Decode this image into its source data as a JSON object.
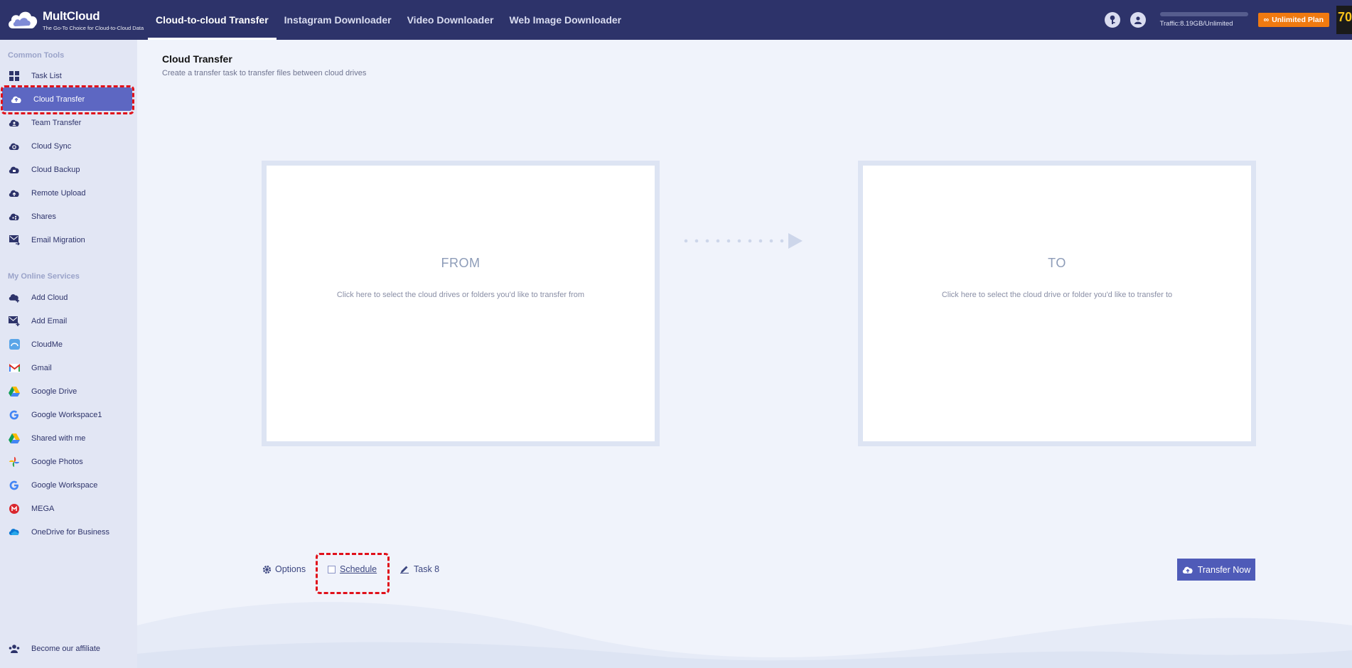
{
  "app": {
    "logo_name": "MultCloud",
    "logo_tagline": "The Go-To Choice for Cloud-to-Cloud Data"
  },
  "nav": {
    "items": [
      {
        "label": "Cloud-to-cloud Transfer",
        "active": true
      },
      {
        "label": "Instagram Downloader",
        "active": false
      },
      {
        "label": "Video Downloader",
        "active": false
      },
      {
        "label": "Web Image Downloader",
        "active": false
      }
    ]
  },
  "header": {
    "traffic_text": "Traffic:8.19GB/Unlimited",
    "plan_label": "Unlimited Plan",
    "corner_badge": "70"
  },
  "sidebar": {
    "common_title": "Common Tools",
    "common_items": [
      {
        "label": "Task List",
        "icon": "grid-icon"
      },
      {
        "label": "Cloud Transfer",
        "icon": "cloud-transfer-icon",
        "active": true
      },
      {
        "label": "Team Transfer",
        "icon": "team-transfer-icon"
      },
      {
        "label": "Cloud Sync",
        "icon": "cloud-sync-icon"
      },
      {
        "label": "Cloud Backup",
        "icon": "cloud-backup-icon"
      },
      {
        "label": "Remote Upload",
        "icon": "remote-upload-icon"
      },
      {
        "label": "Shares",
        "icon": "shares-icon"
      },
      {
        "label": "Email Migration",
        "icon": "email-migration-icon"
      }
    ],
    "online_title": "My Online Services",
    "online_items": [
      {
        "label": "Add Cloud",
        "icon": "add-cloud-icon"
      },
      {
        "label": "Add Email",
        "icon": "add-email-icon"
      },
      {
        "label": "CloudMe",
        "icon": "cloudme-icon"
      },
      {
        "label": "Gmail",
        "icon": "gmail-icon"
      },
      {
        "label": "Google Drive",
        "icon": "google-drive-icon"
      },
      {
        "label": "Google Workspace1",
        "icon": "google-icon"
      },
      {
        "label": "Shared with me",
        "icon": "google-drive-icon"
      },
      {
        "label": "Google Photos",
        "icon": "google-photos-icon"
      },
      {
        "label": "Google Workspace",
        "icon": "google-icon"
      },
      {
        "label": "MEGA",
        "icon": "mega-icon"
      },
      {
        "label": "OneDrive for Business",
        "icon": "onedrive-icon"
      }
    ],
    "footer_items": [
      {
        "label": "Become our affiliate",
        "icon": "affiliate-icon"
      }
    ]
  },
  "main": {
    "title": "Cloud Transfer",
    "subtitle": "Create a transfer task to transfer files between cloud drives",
    "from_title": "FROM",
    "from_desc": "Click here to select the cloud drives or folders you'd like to transfer from",
    "to_title": "TO",
    "to_desc": "Click here to select the cloud drive or folder you'd like to transfer to",
    "options_label": "Options",
    "schedule_label": "Schedule",
    "schedule_checked": false,
    "task_name": "Task 8",
    "transfer_label": "Transfer Now"
  },
  "colors": {
    "topbar": "#2d336a",
    "sidebar": "#e2e6f4",
    "accent": "#5d67c2",
    "plan": "#f07a10",
    "highlight": "#e0101a"
  }
}
